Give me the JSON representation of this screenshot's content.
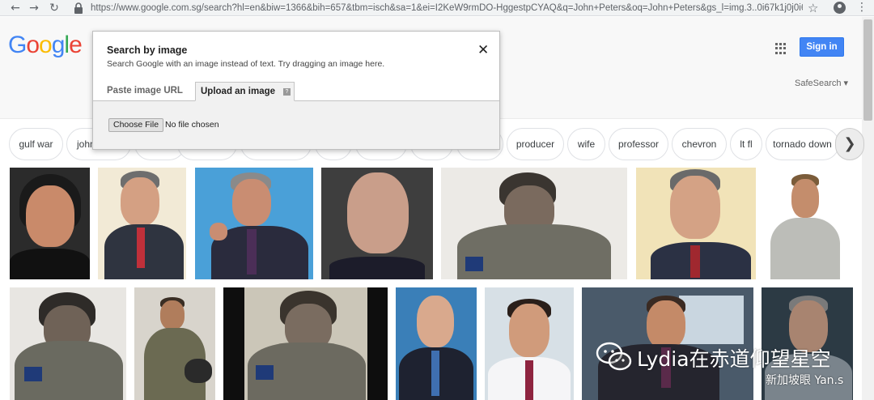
{
  "browser": {
    "back_icon": "arrow-left-icon",
    "forward_icon": "arrow-right-icon",
    "reload_icon": "reload-icon",
    "url": "https://www.google.com.sg/search?hl=en&biw=1366&bih=657&tbm=isch&sa=1&ei=I2KeW9rmDO-HggestpCYAQ&q=John+Peters&oq=John+Peters&gs_l=img.3..0i67k1j0j0i6..."
  },
  "header": {
    "logo_letters": [
      "G",
      "o",
      "o",
      "g",
      "l",
      "e"
    ],
    "logo_colors": [
      "#4285f4",
      "#ea4335",
      "#fbbc05",
      "#4285f4",
      "#34a853",
      "#ea4335"
    ],
    "signin_label": "Sign in",
    "safesearch_label": "SafeSearch ▾"
  },
  "chips": [
    "gulf war",
    "john",
    "producer",
    "wife",
    "professor",
    "chevron",
    "lt fl",
    "tornado down"
  ],
  "dialog": {
    "title": "Search by image",
    "subtitle": "Search Google with an image instead of text. Try dragging an image here.",
    "tab_paste": "Paste image URL",
    "tab_upload": "Upload an image",
    "help_glyph": "?",
    "choose_file": "Choose File",
    "no_file": "No file chosen"
  },
  "watermark": {
    "title": "Lydia在赤道仰望星空",
    "subtitle": "新加坡眼 Yan.s"
  },
  "colors": {
    "accent": "#4285f4",
    "chrome_bg": "#f1f3f4",
    "header_bg": "#f8f8f8"
  }
}
